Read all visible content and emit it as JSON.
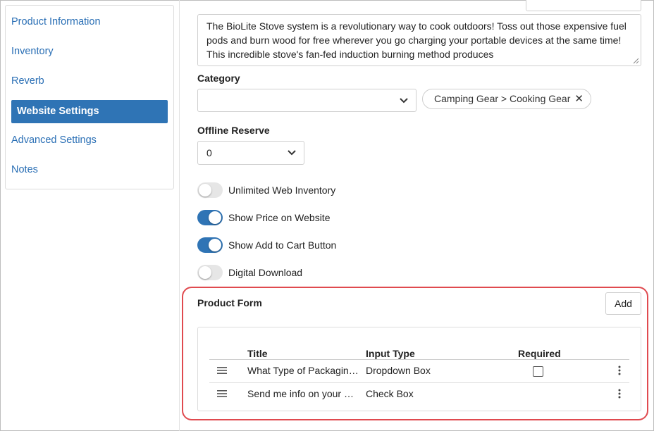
{
  "sidebar": {
    "items": [
      {
        "label": "Product Information",
        "active": false
      },
      {
        "label": "Inventory",
        "active": false
      },
      {
        "label": "Reverb",
        "active": false
      },
      {
        "label": "Website Settings",
        "active": true
      },
      {
        "label": "Advanced Settings",
        "active": false
      },
      {
        "label": "Notes",
        "active": false
      }
    ]
  },
  "description": {
    "text": "The BioLite Stove system is a revolutionary way to cook outdoors! Toss out those expensive fuel pods and burn wood for free wherever you go charging your portable devices at the same time! This incredible stove's fan-fed induction burning method produces"
  },
  "category": {
    "label": "Category",
    "value": "",
    "chip": "Camping Gear > Cooking Gear"
  },
  "offline_reserve": {
    "label": "Offline Reserve",
    "value": "0"
  },
  "toggles": [
    {
      "label": "Unlimited Web Inventory",
      "on": false
    },
    {
      "label": "Show Price on Website",
      "on": true
    },
    {
      "label": "Show Add to Cart Button",
      "on": true
    },
    {
      "label": "Digital Download",
      "on": false
    }
  ],
  "product_form": {
    "title": "Product Form",
    "add_label": "Add",
    "columns": [
      "Title",
      "Input Type",
      "Required"
    ],
    "rows": [
      {
        "title": "What Type of Packagin…",
        "input_type": "Dropdown Box",
        "required": false,
        "has_checkbox": true
      },
      {
        "title": "Send me info on your …",
        "input_type": "Check Box",
        "required": false,
        "has_checkbox": false
      }
    ]
  },
  "colors": {
    "accent": "#2f74b5",
    "link": "#2a6fb5",
    "highlight": "#e04a4f"
  }
}
